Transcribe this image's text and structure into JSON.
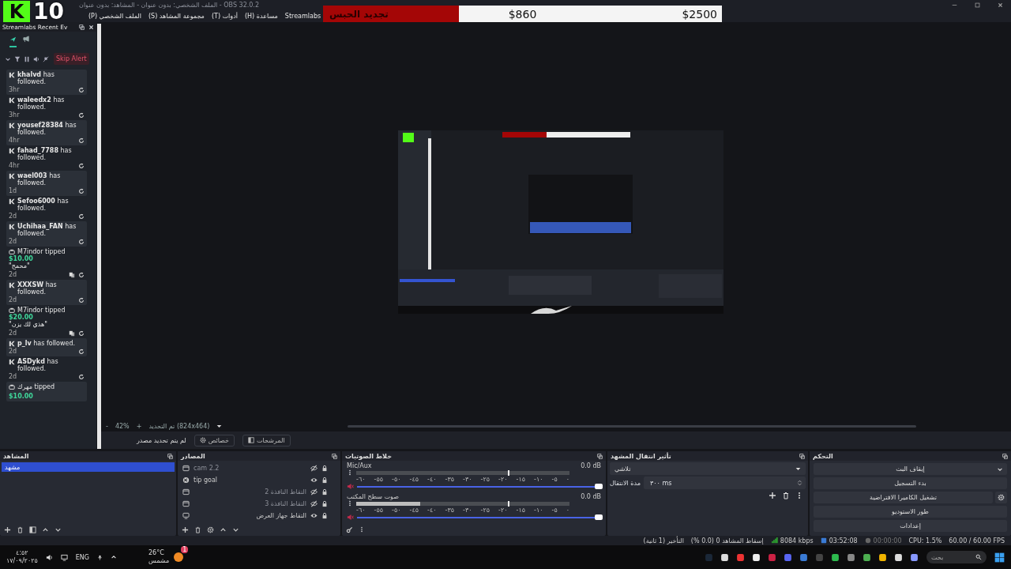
{
  "window": {
    "title": "الملف الشخصي: بدون عنوان - المشاهد: بدون عنوان - OBS 32.0.2"
  },
  "menu": [
    "Streamlabs",
    "(H) مساعدة",
    "(T) أدوات",
    "(S) مجموعة المشاهد",
    "(P) الملف الشخصي"
  ],
  "overlay": {
    "logo": "K",
    "count": "10"
  },
  "goal": {
    "title": "تجديد الحبس",
    "current": "$860",
    "target": "$2500",
    "level": 0.34
  },
  "events_dock": {
    "title": "Streamlabs Recent Ev",
    "skip_button": "Skip Alert",
    "tabs": [
      {
        "kind": "follows",
        "selected": true
      },
      {
        "kind": "alerts",
        "selected": false
      }
    ],
    "events": [
      {
        "kind": "follow",
        "text": "**khalvd** has followed.",
        "time": "3hr"
      },
      {
        "kind": "follow",
        "text": "**waleedx2** has followed.",
        "time": "3hr"
      },
      {
        "kind": "follow",
        "text": "**yousef28384** has followed.",
        "time": "4hr"
      },
      {
        "kind": "follow",
        "text": "**fahad_7788** has followed.",
        "time": "4hr"
      },
      {
        "kind": "follow",
        "text": "**wael003** has followed.",
        "time": "1d"
      },
      {
        "kind": "follow",
        "text": "**Sefoo6000** has followed.",
        "time": "2d"
      },
      {
        "kind": "follow",
        "text": "**Uchihaa_FAN** has followed.",
        "time": "2d"
      },
      {
        "kind": "tip",
        "text": "M7indor tipped",
        "amount": "$10.00",
        "message": "\"محمح\"",
        "time": "2d"
      },
      {
        "kind": "follow",
        "text": "**XXXSW** has followed.",
        "time": "2d"
      },
      {
        "kind": "tip",
        "text": "M7indor tipped",
        "amount": "$20.00",
        "message": "\"هذي لك يزن\"",
        "time": "2d"
      },
      {
        "kind": "follow",
        "text": "**p_lv** has followed.",
        "time": "2d"
      },
      {
        "kind": "follow",
        "text": "**ASDykd** has followed.",
        "time": "2d"
      },
      {
        "kind": "tip",
        "text": "مهرك tipped",
        "amount": "$10.00"
      }
    ]
  },
  "preview": {
    "zoom_out": "-",
    "zoom": "42%",
    "zoom_in": "+",
    "selection": "تم التحديد (824x464)",
    "source_status": "لم يتم تحديد مصدر",
    "properties_button": "خصائص",
    "filters_button": "المرشحات"
  },
  "scenes": {
    "title": "المشاهد",
    "items": [
      {
        "name": "مشهد",
        "selected": true
      }
    ]
  },
  "sources": {
    "title": "المصادر",
    "items": [
      {
        "name": "cam 2.2",
        "kind": "window",
        "visible": false
      },
      {
        "name": "tip goal",
        "kind": "browser",
        "visible": true
      },
      {
        "name": "التقاط النافذة 2",
        "kind": "window",
        "visible": false
      },
      {
        "name": "التقاط النافذة 3",
        "kind": "window",
        "visible": false
      },
      {
        "name": "التقاط جهاز العرض",
        "kind": "display",
        "visible": true
      }
    ]
  },
  "mixer": {
    "title": "خلاط الصوتيات",
    "channels": [
      {
        "name": "Mic/Aux",
        "reading": "0.0 dB",
        "fader": {
          "level": 1
        },
        "ticks": [
          "٠",
          "-٥",
          "-١٠",
          "-١٥",
          "-٢٠",
          "-٢٥",
          "-٣٠",
          "-٣٥",
          "-٤٠",
          "-٤٥",
          "-٥٠",
          "-٥٥",
          "-٦٠"
        ]
      },
      {
        "name": "صوت سطح المكتب",
        "reading": "0.0 dB",
        "meter": {
          "level": 0.3
        },
        "fader": {
          "level": 1
        },
        "ticks": [
          "٠",
          "-٥",
          "-١٠",
          "-١٥",
          "-٢٠",
          "-٢٥",
          "-٣٠",
          "-٣٥",
          "-٤٠",
          "-٤٥",
          "-٥٠",
          "-٥٥",
          "-٦٠"
        ]
      }
    ]
  },
  "transitions": {
    "title": "تأثير انتقال المشهد",
    "effect": "تلاشي",
    "duration_label": "مدة الانتقال",
    "duration": "٣٠٠ ms"
  },
  "controls": {
    "title": "التحكم",
    "buttons": [
      {
        "label": "إيقاف البث",
        "kind": "dropdown"
      },
      {
        "label": "بدء التسجيل",
        "kind": "plain"
      },
      {
        "label": "تشغيل الكاميرا الافتراضية",
        "kind": "gear"
      },
      {
        "label": "طور الاستوديو",
        "kind": "plain"
      },
      {
        "label": "إعدادات",
        "kind": "plain"
      }
    ]
  },
  "status_bar": {
    "delay": "التأخير (1 ثانية)",
    "dropped": "إسقاط المشاهد 0 (0.0 %)",
    "bitrate": "8084 kbps",
    "stream_time": "03:52:08",
    "record_time": "00:00:00",
    "cpu": "CPU: 1.5%",
    "fps": "60.00 / 60.00 FPS"
  },
  "taskbar": {
    "time": "٤:٥٢",
    "date": "١٧/٠٩/٢٠٢٥",
    "language": "ENG",
    "temperature": "26°C",
    "weather": "مشمس",
    "notification_count": "1",
    "search_placeholder": "بحث"
  }
}
